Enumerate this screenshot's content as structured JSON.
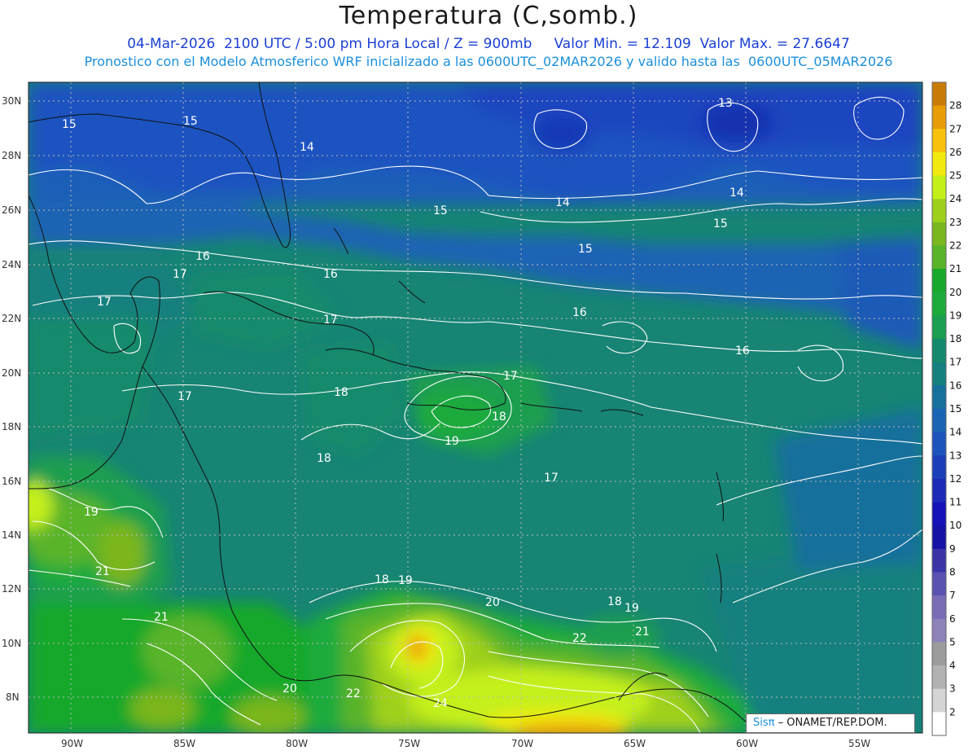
{
  "header": {
    "title": "Temperatura (C,somb.)",
    "line1": "04-Mar-2026  2100 UTC / 5:00 pm Hora Local / Z = 900mb     Valor Min. = 12.109  Valor Max. = 27.6647",
    "line2": "Pronostico con el Modelo Atmosferico WRF inicializado a las 0600UTC_02MAR2026 y valido hasta las  0600UTC_05MAR2026"
  },
  "map": {
    "lat_labels": [
      "30N",
      "28N",
      "26N",
      "24N",
      "22N",
      "20N",
      "18N",
      "16N",
      "14N",
      "12N",
      "10N",
      "8N"
    ],
    "lon_labels": [
      "90W",
      "85W",
      "80W",
      "75W",
      "70W",
      "65W",
      "60W",
      "55W"
    ],
    "contour_labels": [
      "15",
      "15",
      "14",
      "13",
      "14",
      "14",
      "15",
      "15",
      "15",
      "16",
      "16",
      "17",
      "17",
      "16",
      "16",
      "17",
      "17",
      "18",
      "17",
      "18",
      "18",
      "19",
      "17",
      "19",
      "21",
      "21",
      "18",
      "19",
      "20",
      "18",
      "19",
      "22",
      "21",
      "20",
      "22",
      "24"
    ],
    "colorbar": {
      "levels": [
        "2",
        "3",
        "4",
        "5",
        "6",
        "7",
        "8",
        "9",
        "10",
        "11",
        "12",
        "13",
        "14",
        "15",
        "16",
        "17",
        "18",
        "19",
        "20",
        "21",
        "22",
        "23",
        "24",
        "25",
        "26",
        "27",
        "28"
      ],
      "colors": [
        "#ffffff",
        "#d4d4d4",
        "#b2b2b2",
        "#9c9c9c",
        "#8e82b8",
        "#7a6cb6",
        "#5a52b0",
        "#3a34a8",
        "#1612a6",
        "#1512b8",
        "#1d2ab8",
        "#1b3fb8",
        "#1d54bc",
        "#1b64b4",
        "#17709c",
        "#15807e",
        "#148a6c",
        "#1a9e50",
        "#1caa3c",
        "#18a82c",
        "#5ab42a",
        "#7ab61e",
        "#9ed01a",
        "#c4f01a",
        "#f2ea0e",
        "#f8c20c",
        "#e89c08",
        "#c87c06"
      ]
    }
  },
  "credit": {
    "brand": "Sisπ",
    "org": "– ONAMET/REP.DOM."
  }
}
